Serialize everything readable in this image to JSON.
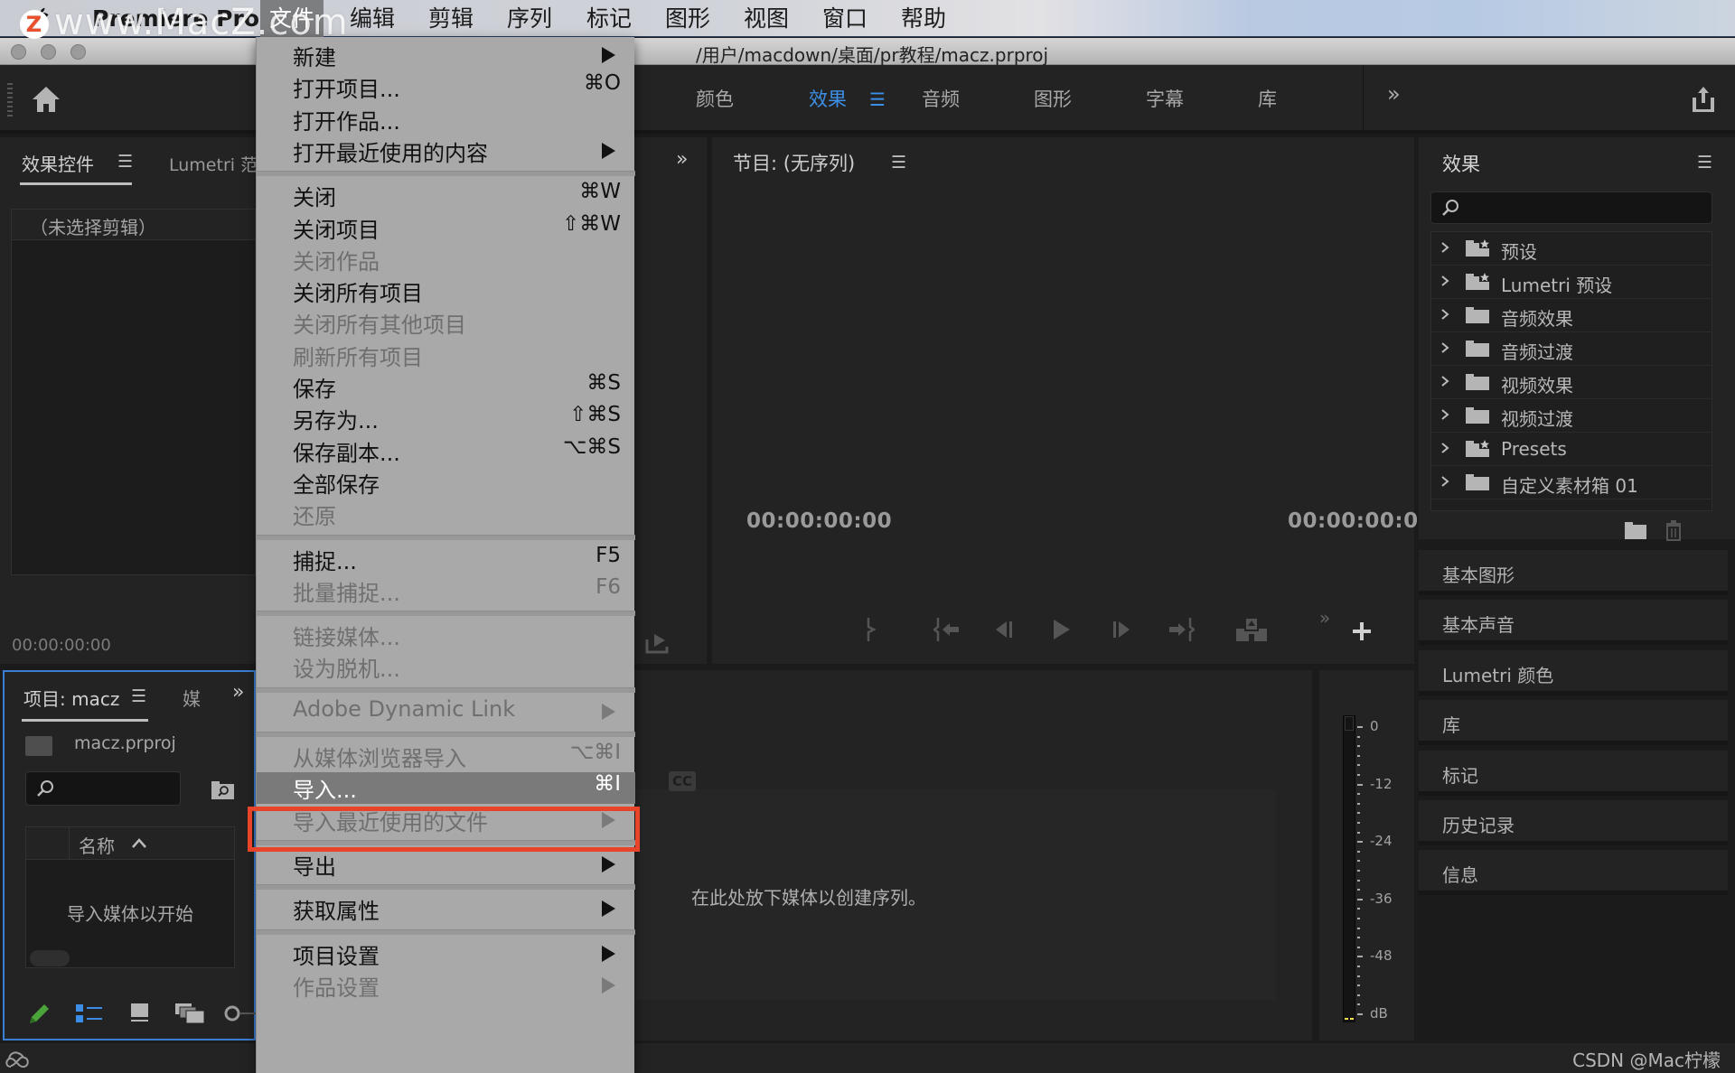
{
  "menubar": {
    "app_name": "Premiere Pro",
    "watermark": "www.MacZ.com",
    "watermark_logo": "Z",
    "items": [
      "文件",
      "编辑",
      "剪辑",
      "序列",
      "标记",
      "图形",
      "视图",
      "窗口",
      "帮助"
    ],
    "active_index": 0
  },
  "window": {
    "path": "/用户/macdown/桌面/pr教程/macz.prproj"
  },
  "workspace": {
    "tabs": [
      {
        "label": "颜色",
        "active": false
      },
      {
        "label": "效果",
        "active": true
      },
      {
        "label": "音频",
        "active": false
      },
      {
        "label": "图形",
        "active": false
      },
      {
        "label": "字幕",
        "active": false
      },
      {
        "label": "库",
        "active": false
      }
    ],
    "more": "»",
    "accent_color": "#3c8fe6"
  },
  "effect_controls": {
    "tab_active": "效果控件",
    "tab_other": "Lumetri 范",
    "no_clip": "（未选择剪辑）",
    "timecode": "00:00:00:00"
  },
  "project": {
    "tab_active": "项目: macz",
    "tab_other": "媒",
    "more": "»",
    "file": "macz.prproj",
    "search_placeholder": "",
    "column_name": "名称",
    "empty_text": "导入媒体以开始"
  },
  "file_menu": {
    "groups": [
      [
        {
          "label": "新建",
          "shortcut": "",
          "submenu": true,
          "enabled": true
        },
        {
          "label": "打开项目...",
          "shortcut": "⌘O",
          "submenu": false,
          "enabled": true
        },
        {
          "label": "打开作品...",
          "shortcut": "",
          "submenu": false,
          "enabled": true
        },
        {
          "label": "打开最近使用的内容",
          "shortcut": "",
          "submenu": true,
          "enabled": true
        }
      ],
      [
        {
          "label": "关闭",
          "shortcut": "⌘W",
          "submenu": false,
          "enabled": true
        },
        {
          "label": "关闭项目",
          "shortcut": "⇧⌘W",
          "submenu": false,
          "enabled": true
        },
        {
          "label": "关闭作品",
          "shortcut": "",
          "submenu": false,
          "enabled": false
        },
        {
          "label": "关闭所有项目",
          "shortcut": "",
          "submenu": false,
          "enabled": true
        },
        {
          "label": "关闭所有其他项目",
          "shortcut": "",
          "submenu": false,
          "enabled": false
        },
        {
          "label": "刷新所有项目",
          "shortcut": "",
          "submenu": false,
          "enabled": false
        },
        {
          "label": "保存",
          "shortcut": "⌘S",
          "submenu": false,
          "enabled": true
        },
        {
          "label": "另存为...",
          "shortcut": "⇧⌘S",
          "submenu": false,
          "enabled": true
        },
        {
          "label": "保存副本...",
          "shortcut": "⌥⌘S",
          "submenu": false,
          "enabled": true
        },
        {
          "label": "全部保存",
          "shortcut": "",
          "submenu": false,
          "enabled": true
        },
        {
          "label": "还原",
          "shortcut": "",
          "submenu": false,
          "enabled": false
        }
      ],
      [
        {
          "label": "捕捉...",
          "shortcut": "F5",
          "submenu": false,
          "enabled": true
        },
        {
          "label": "批量捕捉...",
          "shortcut": "F6",
          "submenu": false,
          "enabled": false
        }
      ],
      [
        {
          "label": "链接媒体...",
          "shortcut": "",
          "submenu": false,
          "enabled": false
        },
        {
          "label": "设为脱机...",
          "shortcut": "",
          "submenu": false,
          "enabled": false
        }
      ],
      [
        {
          "label": "Adobe Dynamic Link",
          "shortcut": "",
          "submenu": true,
          "enabled": false
        }
      ],
      [
        {
          "label": "从媒体浏览器导入",
          "shortcut": "⌥⌘I",
          "submenu": false,
          "enabled": false
        },
        {
          "label": "导入...",
          "shortcut": "⌘I",
          "submenu": false,
          "enabled": true,
          "highlighted": true
        },
        {
          "label": "导入最近使用的文件",
          "shortcut": "",
          "submenu": true,
          "enabled": false
        }
      ],
      [
        {
          "label": "导出",
          "shortcut": "",
          "submenu": true,
          "enabled": true
        }
      ],
      [
        {
          "label": "获取属性",
          "shortcut": "",
          "submenu": true,
          "enabled": true
        }
      ],
      [
        {
          "label": "项目设置",
          "shortcut": "",
          "submenu": true,
          "enabled": true
        },
        {
          "label": "作品设置",
          "shortcut": "",
          "submenu": true,
          "enabled": false
        }
      ]
    ],
    "highlight_box_color": "#e8442a"
  },
  "program_monitor": {
    "title": "节目: (无序列)",
    "timecode_left": "00:00:00:00",
    "timecode_right": "00:00:00:0",
    "more": "»"
  },
  "timeline": {
    "cc_badge": "CC",
    "drop_text": "在此处放下媒体以创建序列。"
  },
  "audio_meter": {
    "labels": [
      "0",
      "-12",
      "-24",
      "-36",
      "-48",
      "dB"
    ],
    "level_color": "#f0e34a"
  },
  "effects_panel": {
    "title": "效果",
    "search_placeholder": "",
    "items": [
      {
        "name": "预设",
        "icon": "folder-star-icon"
      },
      {
        "name": "Lumetri 预设",
        "icon": "folder-star-icon"
      },
      {
        "name": "音频效果",
        "icon": "folder-icon"
      },
      {
        "name": "音频过渡",
        "icon": "folder-icon"
      },
      {
        "name": "视频效果",
        "icon": "folder-icon"
      },
      {
        "name": "视频过渡",
        "icon": "folder-icon"
      },
      {
        "name": "Presets",
        "icon": "folder-star-icon"
      },
      {
        "name": "自定义素材箱 01",
        "icon": "folder-icon"
      }
    ]
  },
  "side_panels": [
    "基本图形",
    "基本声音",
    "Lumetri 颜色",
    "库",
    "标记",
    "历史记录",
    "信息"
  ],
  "status": {
    "credit": "CSDN @Mac柠檬"
  }
}
